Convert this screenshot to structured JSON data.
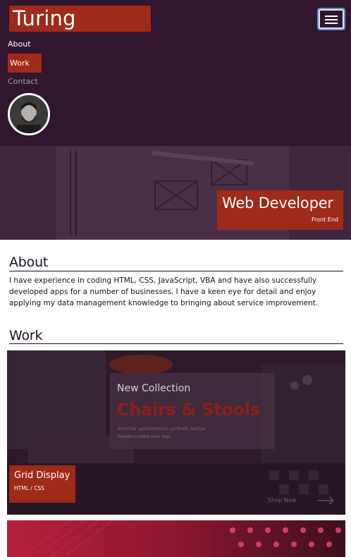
{
  "nav": {
    "brand": "Turing",
    "links": [
      {
        "label": "About"
      },
      {
        "label": "Work"
      },
      {
        "label": "Contact"
      }
    ]
  },
  "hero": {
    "title": "Web Developer",
    "subtitle": "Front End"
  },
  "about": {
    "heading": "About",
    "text": "I have experience in coding HTML, CSS, JavaScript, VBA and have also successfully developed apps for a number of businesses. I have a keen eye for detail and enjoy applying my data management knowledge to bringing about service improvement."
  },
  "work": {
    "heading": "Work",
    "cards": [
      {
        "title": "Grid Display",
        "subtitle": "HTML / CSS",
        "preview": {
          "small_title": "New Collection",
          "big_title": "Chairs & Stools",
          "lines": [
            "Armchair upholstered in synthetic leather",
            "Powder-coated steel legs"
          ],
          "cta": "Shop Now"
        }
      },
      {
        "title": "",
        "subtitle": ""
      }
    ]
  },
  "colors": {
    "nav_bg": "#31162f",
    "accent": "#9e2a1a",
    "text": "#1a1020"
  }
}
